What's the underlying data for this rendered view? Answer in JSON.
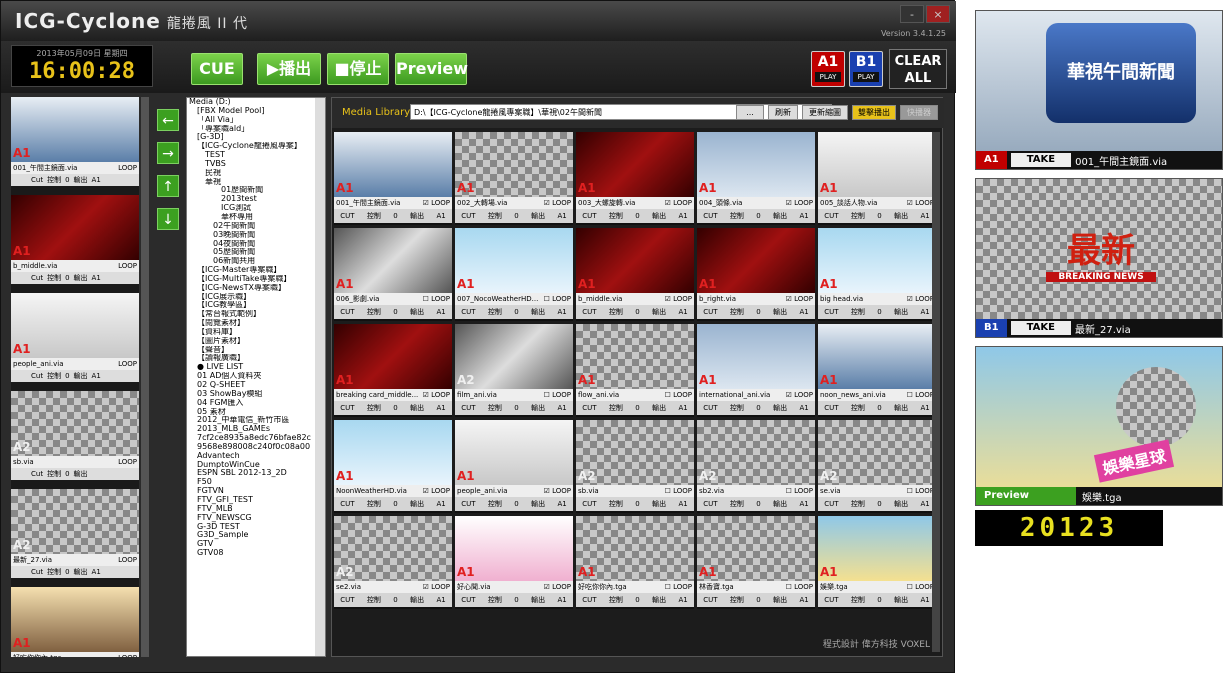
{
  "app": {
    "title": "ICG-Cyclone",
    "subtitle": "龍捲風 II 代",
    "version": "Version 3.4.1.25",
    "min": "-",
    "close": "×"
  },
  "clock": {
    "date": "2013年05月09日 星期四",
    "time": "16:00:28"
  },
  "toolbar": {
    "cue": "CUE",
    "play": "▶播出",
    "stop": "■停止",
    "preview": "Preview",
    "a1": "A1",
    "b1": "B1",
    "play_tag": "PLAY",
    "clear": "CLEAR ALL"
  },
  "left": {
    "items": [
      {
        "name": "001_午間主鏡面.via",
        "ch": "A1",
        "loop": "LOOP",
        "cut": "Cut",
        "ctrl": "控制",
        "n": "0",
        "out": "輸出",
        "o": "A1"
      },
      {
        "name": "b_middle.via",
        "ch": "A1",
        "loop": "LOOP",
        "cut": "Cut",
        "ctrl": "控制",
        "n": "0",
        "out": "輸出",
        "o": "A1"
      },
      {
        "name": "people_ani.via",
        "ch": "A1",
        "loop": "LOOP",
        "cut": "Cut",
        "ctrl": "控制",
        "n": "0",
        "out": "輸出",
        "o": "A1"
      },
      {
        "name": "sb.via",
        "ch": "A2",
        "loop": "LOOP",
        "cut": "Cut",
        "ctrl": "控制",
        "n": "0",
        "out": "輸出",
        "o": ""
      },
      {
        "name": "最新_27.via",
        "ch": "A2",
        "loop": "LOOP",
        "cut": "Cut",
        "ctrl": "控制",
        "n": "0",
        "out": "輸出",
        "o": "A1"
      },
      {
        "name": "好吃你你內.tga",
        "ch": "A1",
        "loop": "LOOP",
        "cut": "",
        "ctrl": "",
        "n": "",
        "out": "",
        "o": ""
      }
    ]
  },
  "arrows": [
    "←",
    "→",
    "↑",
    "↓"
  ],
  "tree": [
    "Media (D:)",
    "[FBX Model Pool]",
    "「All Via」",
    "「專案職ald」",
    "[G-3D]",
    "【ICG-Cyclone龍捲風專案】",
    "TEST",
    "TVBS",
    "民視",
    "華視",
    "01歷間新聞",
    "2013test",
    "ICG測試",
    "華杯專用",
    "02午間新聞",
    "03晚間新聞",
    "04夜間新聞",
    "05歷間新聞",
    "06新聞共用",
    "【ICG-Master專案職】",
    "【ICG-MultiTake專案職】",
    "【ICG-NewsTX專案職】",
    "【ICG展示職】",
    "【ICG教學區】",
    "【常台報式範例】",
    "【閱覽素材】",
    "【資料庫】",
    "【圖片素材】",
    "【聲音】",
    "【讀報廣職】",
    "● LIVE LIST",
    "01 AD個人資料夾",
    "02 Q-SHEET",
    "03 ShowBay模組",
    "04 FGM匯入",
    "05 素材",
    "2012_中華電信_新竹市區",
    "2013_MLB_GAMEs",
    "7cf2ce8935a8edc76bfae82c",
    "9568e898008c240f0c08a00",
    "Advantech",
    "DumptoWinCue",
    "ESPN SBL 2012-13_2D",
    "F50",
    "FGTVN",
    "FTV_GFI_TEST",
    "FTV_MLB",
    "FTV_NEWSCG",
    "G-3D TEST",
    "G3D_Sample",
    "GTV",
    "GTV08"
  ],
  "media": {
    "label": "Media Library",
    "path": "D:\\【ICG-Cyclone龍捲風專案職】\\華視\\02午間新聞",
    "dots": "...",
    "refresh": "刷新",
    "update": "更新縮圖",
    "dual": "雙擊播出",
    "quick": "快播器",
    "grid": [
      {
        "name": "001_午間主鏡面.via",
        "ch": "A1",
        "t": "ang",
        "loop": true
      },
      {
        "name": "002_大轉場.via",
        "ch": "A1",
        "t": "chk",
        "loop": true
      },
      {
        "name": "003_大螺旋轉.via",
        "ch": "A1",
        "t": "red",
        "loop": true
      },
      {
        "name": "004_頭條.via",
        "ch": "A1",
        "t": "news",
        "loop": true
      },
      {
        "name": "005_談話人物.via",
        "ch": "A1",
        "t": "white",
        "loop": true
      },
      {
        "name": "006_影劇.via",
        "ch": "A1",
        "t": "film",
        "loop": false
      },
      {
        "name": "007_NocoWeatherHD...",
        "ch": "A1",
        "t": "blue",
        "loop": false
      },
      {
        "name": "b_middle.via",
        "ch": "A1",
        "t": "red",
        "loop": true
      },
      {
        "name": "b_right.via",
        "ch": "A1",
        "t": "red",
        "loop": true
      },
      {
        "name": "big head.via",
        "ch": "A1",
        "t": "blue",
        "loop": true
      },
      {
        "name": "breaking card_middle...",
        "ch": "A1",
        "t": "red",
        "loop": true
      },
      {
        "name": "film_ani.via",
        "ch": "A2",
        "t": "film",
        "loop": false
      },
      {
        "name": "flow_ani.via",
        "ch": "A1",
        "t": "chk",
        "loop": false
      },
      {
        "name": "international_ani.via",
        "ch": "A1",
        "t": "news",
        "loop": true
      },
      {
        "name": "noon_news_ani.via",
        "ch": "A1",
        "t": "ang",
        "loop": false
      },
      {
        "name": "NoonWeatherHD.via",
        "ch": "A1",
        "t": "blue",
        "loop": true
      },
      {
        "name": "people_ani.via",
        "ch": "A1",
        "t": "white",
        "loop": true
      },
      {
        "name": "sb.via",
        "ch": "A2",
        "t": "chk",
        "loop": false
      },
      {
        "name": "sb2.via",
        "ch": "A2",
        "t": "chk",
        "loop": false
      },
      {
        "name": "se.via",
        "ch": "A2",
        "t": "chk",
        "loop": false
      },
      {
        "name": "se2.via",
        "ch": "A2",
        "t": "chk",
        "loop": true
      },
      {
        "name": "好心聞.via",
        "ch": "A1",
        "t": "pink",
        "loop": true
      },
      {
        "name": "好吃你你內.tga",
        "ch": "A1",
        "t": "chk",
        "loop": false
      },
      {
        "name": "林香寶.tga",
        "ch": "A1",
        "t": "chk",
        "loop": false
      },
      {
        "name": "娛樂.tga",
        "ch": "A1",
        "t": "yel",
        "loop": false
      }
    ],
    "cut": "CUT",
    "ctrl": "控制",
    "zero": "0",
    "out": "輸出",
    "o": "A1",
    "loop": "LOOP"
  },
  "credit": "程式設計 偉方科技 VOXEL",
  "preview": {
    "p1": {
      "title": "華視午間新聞",
      "tag": "A1",
      "take": "TAKE",
      "name": "001_午間主鏡面.via"
    },
    "p2": {
      "title": "最新",
      "sub": "BREAKING NEWS",
      "tag": "B1",
      "take": "TAKE",
      "name": "最新_27.via"
    },
    "p3": {
      "title": "娛樂星球",
      "tag": "Preview",
      "name": "娛樂.tga"
    },
    "counter": "20123"
  },
  "colors": {
    "green": "#3c9a20",
    "yellow": "#e8c21a",
    "red": "#c00000",
    "blue": "#1a40b0"
  }
}
